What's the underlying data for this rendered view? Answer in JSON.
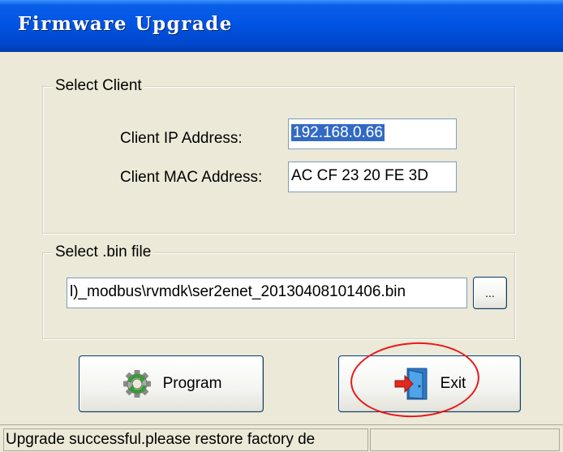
{
  "window": {
    "title": "Firmware Upgrade"
  },
  "client": {
    "group_label": "Select Client",
    "ip_label": "Client IP Address:",
    "ip_value": "192.168.0.66",
    "mac_label": "Client MAC Address:",
    "mac_value": "AC CF 23 20 FE 3D"
  },
  "bin": {
    "group_label": "Select .bin file",
    "path_value": "l)_modbus\\rvmdk\\ser2enet_20130408101406.bin",
    "browse_label": "..."
  },
  "buttons": {
    "program_label": "Program",
    "exit_label": "Exit",
    "program_icon": "gear-refresh-icon",
    "exit_icon": "exit-door-icon"
  },
  "status": {
    "message": "Upgrade successful.please restore factory de"
  },
  "colors": {
    "title_bar": "#0054e3",
    "window_bg": "#ece9d8",
    "selection": "#316ac5",
    "annotation": "#e8191c"
  }
}
